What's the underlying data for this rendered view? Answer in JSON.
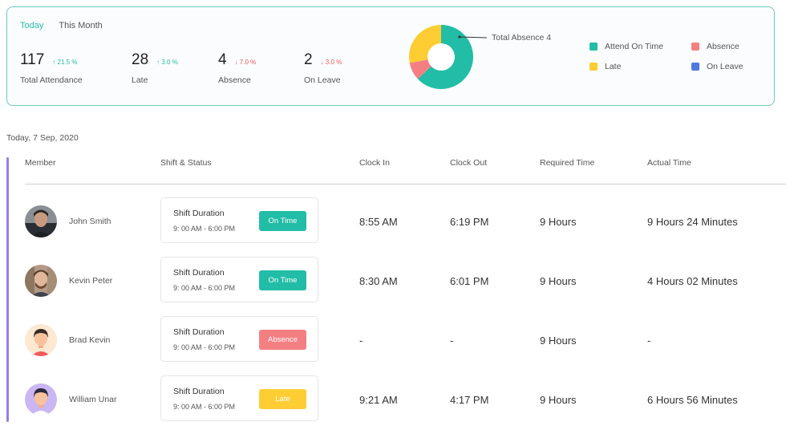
{
  "tabs": [
    {
      "label": "Today",
      "active": true
    },
    {
      "label": "This Month",
      "active": false
    }
  ],
  "stats": [
    {
      "value": "117",
      "change": "↑ 21.5 %",
      "direction": "up",
      "label": "Total Attendance"
    },
    {
      "value": "28",
      "change": "↑ 3.0 %",
      "direction": "up",
      "label": "Late"
    },
    {
      "value": "4",
      "change": "↓ 7.0 %",
      "direction": "down",
      "label": "Absence"
    },
    {
      "value": "2",
      "change": "↓ 3.0 %",
      "direction": "down",
      "label": "On Leave"
    }
  ],
  "donut": {
    "callout": "Total Absence 4",
    "segments": [
      {
        "category": "Attend On Time",
        "value": 63,
        "color": "#22bda6"
      },
      {
        "category": "Absence",
        "value": 9,
        "color": "#f47f83"
      },
      {
        "category": "Late",
        "value": 28,
        "color": "#fdcd33"
      }
    ]
  },
  "legend": [
    {
      "label": "Attend On Time",
      "color": "#22bda6"
    },
    {
      "label": "Absence",
      "color": "#f47f83"
    },
    {
      "label": "Late",
      "color": "#fdcd33"
    },
    {
      "label": "On Leave",
      "color": "#4d79e0"
    }
  ],
  "date_heading": "Today, 7 Sep, 2020",
  "columns": [
    "Member",
    "Shift & Status",
    "Clock In",
    "Clock Out",
    "Required Time",
    "Actual Time"
  ],
  "rows": [
    {
      "name": "John Smith",
      "avatar": "avatar-photo-john",
      "shift_title": "Shift Duration",
      "shift_time": "9: 00 AM - 6:00 PM",
      "status": "On Time",
      "status_color": "#22bda6",
      "clock_in": "8:55 AM",
      "clock_out": "6:19 PM",
      "required": "9 Hours",
      "actual": "9 Hours 24 Minutes"
    },
    {
      "name": "Kevin Peter",
      "avatar": "avatar-photo-kevin",
      "shift_title": "Shift Duration",
      "shift_time": "9: 00 AM - 6:00 PM",
      "status": "On Time",
      "status_color": "#22bda6",
      "clock_in": "8:30 AM",
      "clock_out": "6:01 PM",
      "required": "9 Hours",
      "actual": "4 Hours 02 Minutes"
    },
    {
      "name": "Brad Kevin",
      "avatar": "avatar-illustration-brad",
      "shift_title": "Shift Duration",
      "shift_time": "9: 00 AM - 6:00 PM",
      "status": "Absence",
      "status_color": "#f47f83",
      "clock_in": "-",
      "clock_out": "-",
      "required": "9 Hours",
      "actual": "-"
    },
    {
      "name": "William Unar",
      "avatar": "avatar-illustration-william",
      "shift_title": "Shift Duration",
      "shift_time": "9: 00 AM - 6:00 PM",
      "status": "Late",
      "status_color": "#fdcd33",
      "clock_in": "9:21 AM",
      "clock_out": "4:17 PM",
      "required": "9 Hours",
      "actual": "6 Hours 56 Minutes"
    }
  ]
}
